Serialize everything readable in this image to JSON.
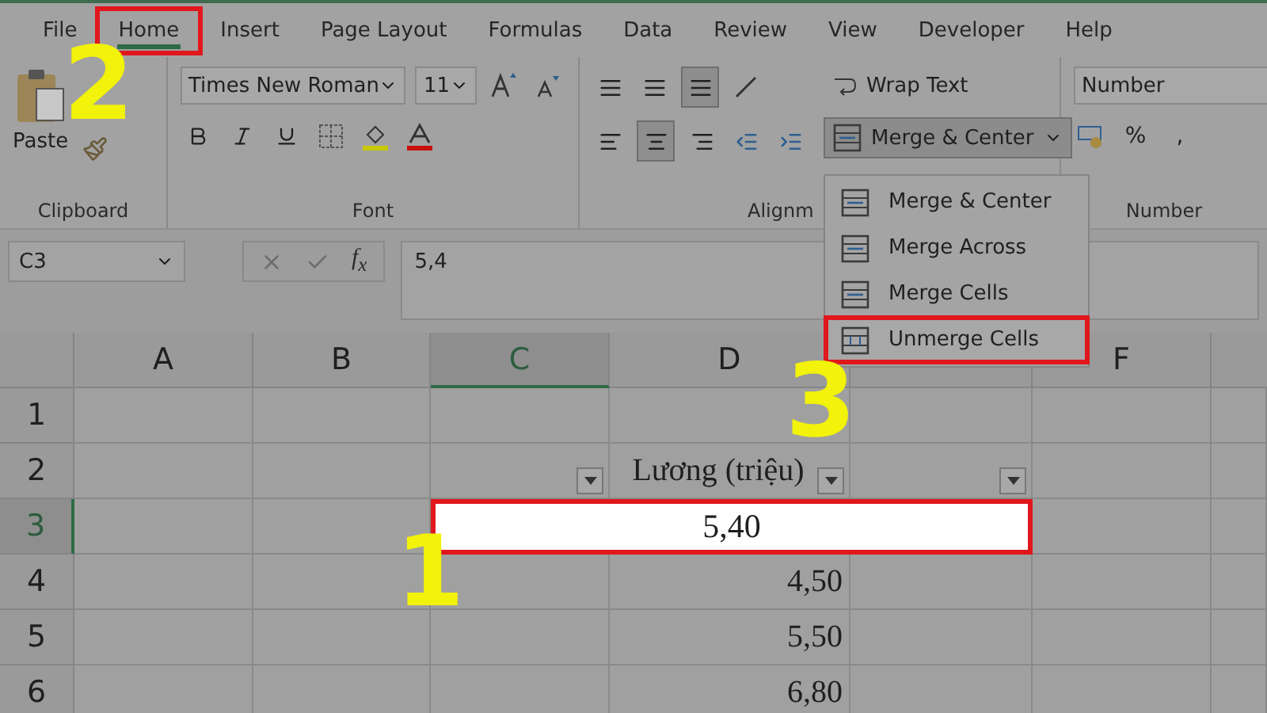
{
  "tabs": [
    {
      "label": "File",
      "selected": false,
      "annotated": false
    },
    {
      "label": "Home",
      "selected": true,
      "annotated": true
    },
    {
      "label": "Insert",
      "selected": false,
      "annotated": false
    },
    {
      "label": "Page Layout",
      "selected": false,
      "annotated": false
    },
    {
      "label": "Formulas",
      "selected": false,
      "annotated": false
    },
    {
      "label": "Data",
      "selected": false,
      "annotated": false
    },
    {
      "label": "Review",
      "selected": false,
      "annotated": false
    },
    {
      "label": "View",
      "selected": false,
      "annotated": false
    },
    {
      "label": "Developer",
      "selected": false,
      "annotated": false
    },
    {
      "label": "Help",
      "selected": false,
      "annotated": false
    }
  ],
  "ribbon": {
    "clipboard": {
      "label": "Clipboard",
      "paste": "Paste"
    },
    "font": {
      "label": "Font",
      "name": "Times New Roman",
      "size": "11"
    },
    "alignment": {
      "label": "Alignm",
      "wrap_text": "Wrap Text",
      "merge_button": "Merge & Center"
    },
    "number": {
      "label": "Number",
      "format": "Number",
      "percent": "%",
      "comma": ","
    }
  },
  "merge_menu": {
    "items": [
      {
        "label": "Merge & Center",
        "annotated": false
      },
      {
        "label": "Merge Across",
        "annotated": false
      },
      {
        "label": "Merge Cells",
        "annotated": false
      },
      {
        "label": "Unmerge Cells",
        "annotated": true
      }
    ]
  },
  "formula_bar": {
    "name_box": "C3",
    "function_label": "f$_{x}$",
    "value": "5,4"
  },
  "columns": [
    {
      "label": "A",
      "selected": false
    },
    {
      "label": "B",
      "selected": false
    },
    {
      "label": "C",
      "selected": true
    },
    {
      "label": "D",
      "selected": false
    },
    {
      "selected": false
    },
    {
      "label": "F",
      "selected": false
    }
  ],
  "rows": [
    {
      "number": "1",
      "selected": false,
      "kind": "empty"
    },
    {
      "number": "2",
      "selected": false,
      "kind": "heading",
      "text": "Lương (triệu)"
    },
    {
      "number": "3",
      "selected": true,
      "kind": "merged",
      "text": "5,40",
      "annotated": true
    },
    {
      "number": "4",
      "selected": false,
      "kind": "value",
      "text": "4,50"
    },
    {
      "number": "5",
      "selected": false,
      "kind": "value",
      "text": "5,50"
    },
    {
      "number": "6",
      "selected": false,
      "kind": "value",
      "text": "6,80"
    }
  ],
  "step_markers": [
    {
      "text": "2"
    },
    {
      "text": "3"
    },
    {
      "text": "1"
    }
  ]
}
